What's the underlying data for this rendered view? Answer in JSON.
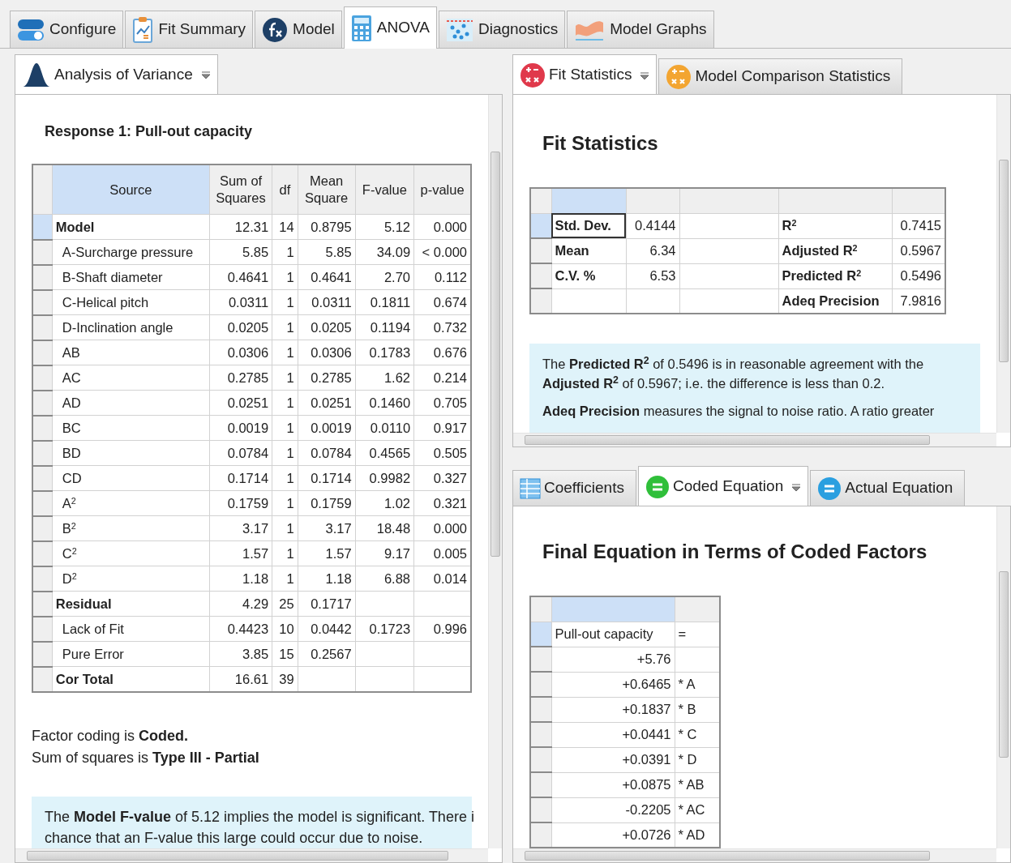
{
  "main_tabs": [
    {
      "label": "Configure",
      "selected": false
    },
    {
      "label": "Fit Summary",
      "selected": false
    },
    {
      "label": "Model",
      "selected": false
    },
    {
      "label": "ANOVA",
      "selected": true
    },
    {
      "label": "Diagnostics",
      "selected": false
    },
    {
      "label": "Model Graphs",
      "selected": false
    }
  ],
  "anova_panel": {
    "tabs": [
      {
        "label": "Analysis of Variance",
        "selected": true,
        "menu": true
      }
    ],
    "title": "Response 1: Pull-out capacity",
    "table": {
      "columns": [
        {
          "label": "Source",
          "selected": true
        },
        {
          "label": "Sum of Squares",
          "selected": false
        },
        {
          "label": "df",
          "selected": false
        },
        {
          "label": "Mean Square",
          "selected": false
        },
        {
          "label": "F-value",
          "selected": false
        },
        {
          "label": "p-value",
          "selected": false
        }
      ],
      "rows": [
        {
          "kind": "group",
          "selected": true,
          "cells": [
            "Model",
            "12.31",
            "14",
            "0.8795",
            "5.12",
            "0.000"
          ]
        },
        {
          "kind": "term",
          "selected": false,
          "cells": [
            "A-Surcharge pressure",
            "5.85",
            "1",
            "5.85",
            "34.09",
            "< 0.000"
          ]
        },
        {
          "kind": "term",
          "selected": false,
          "cells": [
            "B-Shaft diameter",
            "0.4641",
            "1",
            "0.4641",
            "2.70",
            "0.112"
          ]
        },
        {
          "kind": "term",
          "selected": false,
          "cells": [
            "C-Helical pitch",
            "0.0311",
            "1",
            "0.0311",
            "0.1811",
            "0.674"
          ]
        },
        {
          "kind": "term",
          "selected": false,
          "cells": [
            "D-Inclination angle",
            "0.0205",
            "1",
            "0.0205",
            "0.1194",
            "0.732"
          ]
        },
        {
          "kind": "term",
          "selected": false,
          "cells": [
            "AB",
            "0.0306",
            "1",
            "0.0306",
            "0.1783",
            "0.676"
          ]
        },
        {
          "kind": "term",
          "selected": false,
          "cells": [
            "AC",
            "0.2785",
            "1",
            "0.2785",
            "1.62",
            "0.214"
          ]
        },
        {
          "kind": "term",
          "selected": false,
          "cells": [
            "AD",
            "0.0251",
            "1",
            "0.0251",
            "0.1460",
            "0.705"
          ]
        },
        {
          "kind": "term",
          "selected": false,
          "cells": [
            "BC",
            "0.0019",
            "1",
            "0.0019",
            "0.0110",
            "0.917"
          ]
        },
        {
          "kind": "term",
          "selected": false,
          "cells": [
            "BD",
            "0.0784",
            "1",
            "0.0784",
            "0.4565",
            "0.505"
          ]
        },
        {
          "kind": "term",
          "selected": false,
          "cells": [
            "CD",
            "0.1714",
            "1",
            "0.1714",
            "0.9982",
            "0.327"
          ]
        },
        {
          "kind": "term",
          "selected": false,
          "cells": [
            "A$^{2}$",
            "0.1759",
            "1",
            "0.1759",
            "1.02",
            "0.321"
          ]
        },
        {
          "kind": "term",
          "selected": false,
          "cells": [
            "B$^{2}$",
            "3.17",
            "1",
            "3.17",
            "18.48",
            "0.000"
          ]
        },
        {
          "kind": "term",
          "selected": false,
          "cells": [
            "C$^{2}$",
            "1.57",
            "1",
            "1.57",
            "9.17",
            "0.005"
          ]
        },
        {
          "kind": "term",
          "selected": false,
          "cells": [
            "D$^{2}$",
            "1.18",
            "1",
            "1.18",
            "6.88",
            "0.014"
          ]
        },
        {
          "kind": "group",
          "selected": false,
          "cells": [
            "Residual",
            "4.29",
            "25",
            "0.1717",
            null,
            null
          ]
        },
        {
          "kind": "term",
          "selected": false,
          "cells": [
            "Lack of Fit",
            "0.4423",
            "10",
            "0.0442",
            "0.1723",
            "0.996"
          ]
        },
        {
          "kind": "term",
          "selected": false,
          "cells": [
            "Pure Error",
            "3.85",
            "15",
            "0.2567",
            null,
            null
          ]
        },
        {
          "kind": "group",
          "selected": false,
          "cells": [
            "Cor Total",
            "16.61",
            "39",
            null,
            null,
            null
          ]
        }
      ]
    },
    "notes": [
      "Factor coding is **Coded.**",
      "Sum of squares is **Type III - Partial**"
    ],
    "info": [
      "The **Model F-value** of 5.12 implies the model is significant. There i",
      "chance that an F-value this large could occur due to noise."
    ]
  },
  "fit_panel": {
    "tabs": [
      {
        "label": "Fit Statistics",
        "selected": true,
        "menu": true
      },
      {
        "label": "Model Comparison Statistics",
        "selected": false,
        "menu": false
      }
    ],
    "title": "Fit Statistics",
    "table": {
      "columns": [
        {
          "selected": true
        },
        {
          "selected": false
        },
        {
          "selected": false
        },
        {
          "selected": false
        },
        {
          "selected": false
        }
      ],
      "rows": [
        {
          "selected": true,
          "cells": [
            "Std. Dev.",
            "0.4144",
            null,
            "R$^{2}$",
            "0.7415"
          ]
        },
        {
          "selected": false,
          "cells": [
            "Mean",
            "6.34",
            null,
            "Adjusted R$^{2}$",
            "0.5967"
          ]
        },
        {
          "selected": false,
          "cells": [
            "C.V. %",
            "6.53",
            null,
            "Predicted R$^{2}$",
            "0.5496"
          ]
        },
        {
          "selected": false,
          "cells": [
            null,
            null,
            null,
            "Adeq Precision",
            "7.9816"
          ]
        }
      ]
    },
    "info": [
      "The **Predicted R$^{2}$** of 0.5496 is in reasonable agreement with the **Adjusted R$^{2}$** of 0.5967; i.e. the difference is less than 0.2.",
      "**Adeq Precision** measures the signal to noise ratio. A ratio greater"
    ]
  },
  "equation_panel": {
    "tabs": [
      {
        "label": "Coefficients",
        "selected": false,
        "menu": false
      },
      {
        "label": "Coded Equation",
        "selected": true,
        "menu": true
      },
      {
        "label": "Actual Equation",
        "selected": false,
        "menu": false
      }
    ],
    "title": "Final Equation in Terms of Coded Factors",
    "table": {
      "columns": [
        {
          "selected": true
        },
        {
          "selected": false
        }
      ],
      "rows": [
        {
          "kind": "response",
          "selected": true,
          "coefficient": "Pull-out capacity",
          "term": "="
        },
        {
          "kind": "term",
          "selected": false,
          "coefficient": "+5.76"
        },
        {
          "kind": "term",
          "selected": false,
          "coefficient": "+0.6465",
          "term": "* A"
        },
        {
          "kind": "term",
          "selected": false,
          "coefficient": "+0.1837",
          "term": "* B"
        },
        {
          "kind": "term",
          "selected": false,
          "coefficient": "+0.0441",
          "term": "* C"
        },
        {
          "kind": "term",
          "selected": false,
          "coefficient": "+0.0391",
          "term": "* D"
        },
        {
          "kind": "term",
          "selected": false,
          "coefficient": "+0.0875",
          "term": "* AB"
        },
        {
          "kind": "term",
          "selected": false,
          "coefficient": "-0.2205",
          "term": "* AC"
        },
        {
          "kind": "term",
          "selected": false,
          "coefficient": "+0.0726",
          "term": "* AD"
        }
      ]
    }
  }
}
